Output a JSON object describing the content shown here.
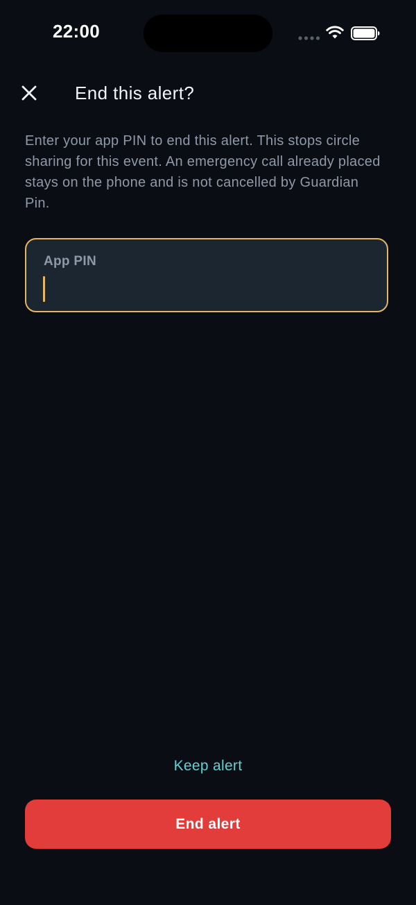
{
  "status_bar": {
    "time": "22:00",
    "icons": [
      "signal-dots-icon",
      "wifi-icon",
      "battery-icon"
    ]
  },
  "header": {
    "close_icon": "close-icon",
    "title": "End this alert?"
  },
  "description": "Enter your app PIN to end this alert. This stops circle sharing for this event. An emergency call already placed stays on the phone and is not cancelled by Guardian Pin.",
  "pin_field": {
    "label": "App PIN",
    "value": "",
    "focused": true
  },
  "actions": {
    "keep_alert_label": "Keep alert",
    "end_alert_label": "End alert"
  },
  "colors": {
    "background": "#0a0d13",
    "field_background": "#1c2631",
    "field_focus_border": "#e3b764",
    "accent_link": "#5fd3d6",
    "danger": "#e23d3b",
    "muted_text": "#8f99a8"
  }
}
